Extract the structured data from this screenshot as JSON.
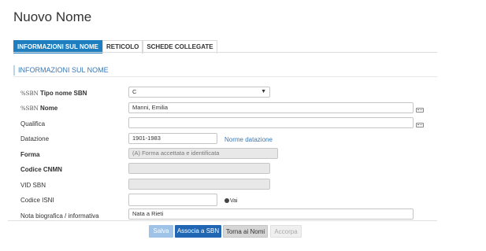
{
  "page": {
    "title": "Nuovo Nome"
  },
  "tabs": [
    {
      "label": "INFORMAZIONI SUL NOME",
      "active": true
    },
    {
      "label": "RETICOLO",
      "active": false
    },
    {
      "label": "SCHEDE COLLEGATE",
      "active": false
    }
  ],
  "section": {
    "title": "INFORMAZIONI SUL NOME"
  },
  "sbn_tag": "SBN",
  "form": {
    "tipo_nome": {
      "label": "Tipo nome SBN",
      "value": "C"
    },
    "nome": {
      "label": "Nome",
      "value": "Manni, Emilia"
    },
    "qualifica": {
      "label": "Qualifica",
      "value": ""
    },
    "datazione": {
      "label": "Datazione",
      "value": "1901-1983",
      "link": "Norme datazione"
    },
    "forma": {
      "label": "Forma",
      "value": "(A) Forma accettata e identificata"
    },
    "codice_cnmn": {
      "label": "Codice CNMN",
      "value": ""
    },
    "vid_sbn": {
      "label": "VID SBN",
      "value": ""
    },
    "codice_isni": {
      "label": "Codice ISNI",
      "value": "",
      "action": "Vai"
    },
    "nota": {
      "label": "Nota biografica / informativa",
      "value": "Nata a Rieti"
    }
  },
  "buttons": {
    "save": "Salva",
    "associate": "Associa a SBN",
    "back": "Torna ai Nomi",
    "accept": "Accorpa"
  },
  "colors": {
    "accent": "#1e7ebf",
    "primary_button": "#2166b3"
  }
}
